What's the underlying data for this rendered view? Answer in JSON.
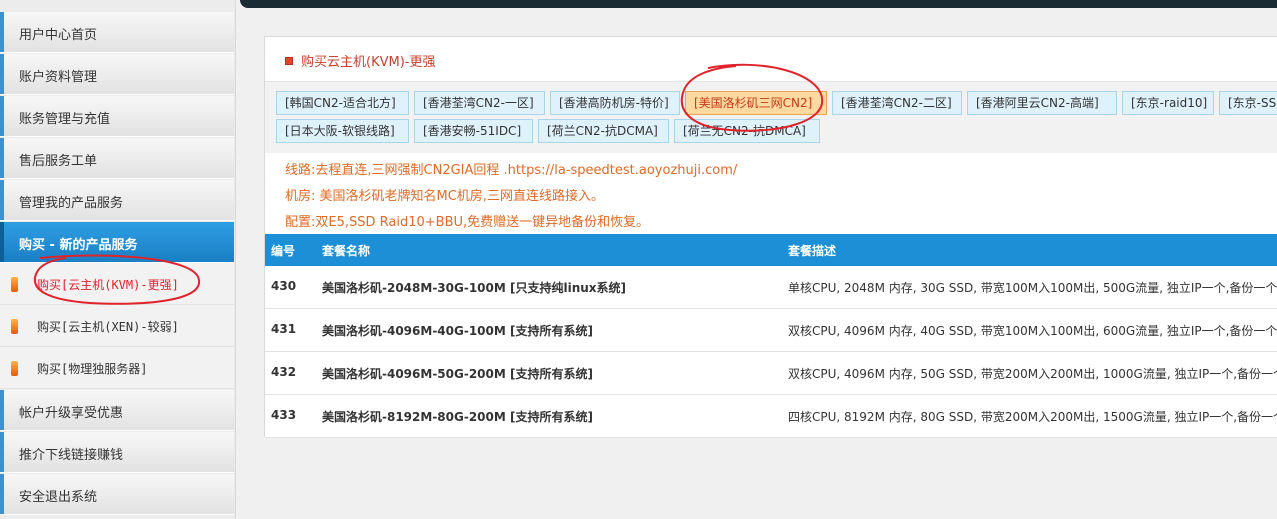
{
  "sidebar": {
    "items": [
      {
        "label": "用户中心首页"
      },
      {
        "label": "账户资料管理"
      },
      {
        "label": "账务管理与充值"
      },
      {
        "label": "售后服务工单"
      },
      {
        "label": "管理我的产品服务"
      },
      {
        "label": "购买 - 新的产品服务"
      }
    ],
    "sub_items": [
      {
        "label": "购买[云主机(KVM)-更强]"
      },
      {
        "label": "购买[云主机(XEN)-较弱]"
      },
      {
        "label": "购买[物理独服务器]"
      }
    ],
    "bottom_items": [
      {
        "label": "帐户升级享受优惠"
      },
      {
        "label": "推介下线链接赚钱"
      },
      {
        "label": "安全退出系统"
      }
    ]
  },
  "panel": {
    "title": "购买云主机(KVM)-更强",
    "tabs_row1": [
      {
        "label": "[韩国CN2-适合北方]"
      },
      {
        "label": "[香港荃湾CN2-一区]"
      },
      {
        "label": "[香港高防机房-特价]"
      },
      {
        "label": "[美国洛杉矶三网CN2]"
      },
      {
        "label": "[香港荃湾CN2-二区]"
      },
      {
        "label": "[香港阿里云CN2-高端]"
      },
      {
        "label": "[东京-raid10]"
      },
      {
        "label": "[东京-SS"
      }
    ],
    "tabs_row2": [
      {
        "label": "[日本大阪-软银线路]"
      },
      {
        "label": "[香港安畅-51IDC]"
      },
      {
        "label": "[荷兰CN2-抗DCMA]"
      },
      {
        "label": "[荷兰无CN2-抗DMCA]"
      }
    ],
    "info": {
      "line": "线路:去程直连,三网强制CN2GIA回程 .https://la-speedtest.aoyozhuji.com/",
      "room": "机房: 美国洛杉矶老牌知名MC机房,三网直连线路接入。",
      "config": "配置:双E5,SSD Raid10+BBU,免费赠送一键异地备份和恢复。"
    },
    "table": {
      "headers": {
        "id": "编号",
        "name": "套餐名称",
        "desc": "套餐描述"
      },
      "rows": [
        {
          "id": "430",
          "name": "美国洛杉矶-2048M-30G-100M [只支持纯linux系统]",
          "desc": "单核CPU, 2048M 内存, 30G SSD, 带宽100M入100M出, 500G流量, 独立IP一个,备份一个"
        },
        {
          "id": "431",
          "name": "美国洛杉矶-4096M-40G-100M [支持所有系统]",
          "desc": "双核CPU, 4096M 内存, 40G SSD, 带宽100M入100M出, 600G流量, 独立IP一个,备份一个"
        },
        {
          "id": "432",
          "name": "美国洛杉矶-4096M-50G-200M [支持所有系统]",
          "desc": "双核CPU, 4096M 内存, 50G SSD, 带宽200M入200M出, 1000G流量, 独立IP一个,备份一个"
        },
        {
          "id": "433",
          "name": "美国洛杉矶-8192M-80G-200M [支持所有系统]",
          "desc": "四核CPU, 8192M 内存, 80G SSD, 带宽200M入200M出, 1500G流量, 独立IP一个,备份一个"
        }
      ]
    }
  },
  "colors": {
    "accent_blue": "#1c8fd6",
    "title_red": "#c7402b",
    "info_orange": "#e06a26",
    "annotation_red": "#e0232b"
  }
}
